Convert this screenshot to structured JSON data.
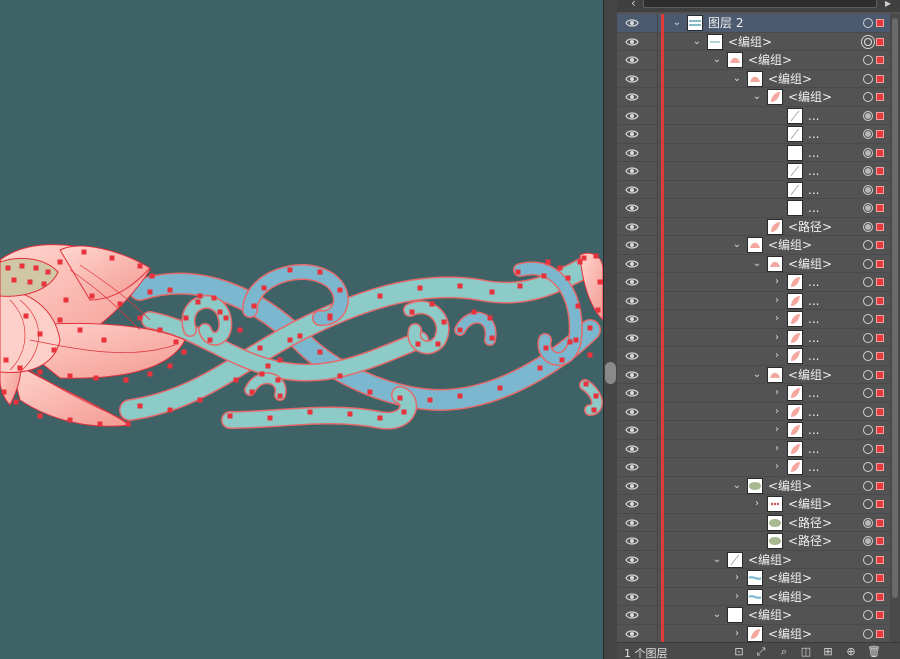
{
  "panel": {
    "search_placeholder": "",
    "layer_count": "1 个图层",
    "rows": [
      {
        "name": "图层 2",
        "depth": 0,
        "chevron": "expanded",
        "thumb": "layer",
        "selected": true,
        "target": "hollow"
      },
      {
        "name": "<编组>",
        "depth": 1,
        "chevron": "expanded",
        "thumb": "group",
        "target": "double"
      },
      {
        "name": "<编组>",
        "depth": 2,
        "chevron": "expanded",
        "thumb": "lotus",
        "target": "hollow"
      },
      {
        "name": "<编组>",
        "depth": 3,
        "chevron": "expanded",
        "thumb": "lotus",
        "target": "hollow"
      },
      {
        "name": "<编组>",
        "depth": 4,
        "chevron": "expanded",
        "thumb": "petal",
        "target": "hollow"
      },
      {
        "name": "...",
        "depth": 5,
        "chevron": "none",
        "thumb": "line",
        "target": "filled"
      },
      {
        "name": "...",
        "depth": 5,
        "chevron": "none",
        "thumb": "line",
        "target": "filled"
      },
      {
        "name": "...",
        "depth": 5,
        "chevron": "none",
        "thumb": "blank",
        "target": "filled"
      },
      {
        "name": "...",
        "depth": 5,
        "chevron": "none",
        "thumb": "line",
        "target": "filled"
      },
      {
        "name": "...",
        "depth": 5,
        "chevron": "none",
        "thumb": "line",
        "target": "filled"
      },
      {
        "name": "...",
        "depth": 5,
        "chevron": "none",
        "thumb": "blank",
        "target": "filled"
      },
      {
        "name": "<路径>",
        "depth": 4,
        "chevron": "none",
        "thumb": "petal",
        "target": "filled"
      },
      {
        "name": "<编组>",
        "depth": 3,
        "chevron": "expanded",
        "thumb": "lotus",
        "target": "hollow"
      },
      {
        "name": "<编组>",
        "depth": 4,
        "chevron": "expanded",
        "thumb": "lotus",
        "target": "hollow"
      },
      {
        "name": "...",
        "depth": 5,
        "chevron": "collapsed",
        "thumb": "petal",
        "target": "hollow"
      },
      {
        "name": "...",
        "depth": 5,
        "chevron": "collapsed",
        "thumb": "petal",
        "target": "hollow"
      },
      {
        "name": "...",
        "depth": 5,
        "chevron": "collapsed",
        "thumb": "petal",
        "target": "hollow"
      },
      {
        "name": "...",
        "depth": 5,
        "chevron": "collapsed",
        "thumb": "petal",
        "target": "hollow"
      },
      {
        "name": "...",
        "depth": 5,
        "chevron": "collapsed",
        "thumb": "petal",
        "target": "hollow"
      },
      {
        "name": "<编组>",
        "depth": 4,
        "chevron": "expanded",
        "thumb": "lotus",
        "target": "hollow"
      },
      {
        "name": "...",
        "depth": 5,
        "chevron": "collapsed",
        "thumb": "petal",
        "target": "hollow"
      },
      {
        "name": "...",
        "depth": 5,
        "chevron": "collapsed",
        "thumb": "petal",
        "target": "hollow"
      },
      {
        "name": "...",
        "depth": 5,
        "chevron": "collapsed",
        "thumb": "petal",
        "target": "hollow"
      },
      {
        "name": "...",
        "depth": 5,
        "chevron": "collapsed",
        "thumb": "petal",
        "target": "hollow"
      },
      {
        "name": "...",
        "depth": 5,
        "chevron": "collapsed",
        "thumb": "petal",
        "target": "hollow"
      },
      {
        "name": "<编组>",
        "depth": 3,
        "chevron": "expanded",
        "thumb": "seedpod",
        "target": "hollow"
      },
      {
        "name": "<编组>",
        "depth": 4,
        "chevron": "collapsed",
        "thumb": "dots",
        "target": "hollow"
      },
      {
        "name": "<路径>",
        "depth": 4,
        "chevron": "none",
        "thumb": "seedpod",
        "target": "filled"
      },
      {
        "name": "<路径>",
        "depth": 4,
        "chevron": "none",
        "thumb": "seedpod",
        "target": "filled"
      },
      {
        "name": "<编组>",
        "depth": 2,
        "chevron": "expanded",
        "thumb": "line",
        "target": "hollow"
      },
      {
        "name": "<编组>",
        "depth": 3,
        "chevron": "collapsed",
        "thumb": "scroll",
        "target": "hollow"
      },
      {
        "name": "<编组>",
        "depth": 3,
        "chevron": "collapsed",
        "thumb": "scroll",
        "target": "hollow"
      },
      {
        "name": "<编组>",
        "depth": 2,
        "chevron": "expanded",
        "thumb": "blank",
        "target": "hollow"
      },
      {
        "name": "<编组>",
        "depth": 3,
        "chevron": "collapsed",
        "thumb": "petal",
        "target": "hollow"
      }
    ]
  },
  "colors": {
    "canvas_bg": "#3f6267",
    "panel_bg": "#535353",
    "selected_row": "#4c5a70",
    "layer_color": "#e03a3a",
    "vine_blue": "#7bb8cf",
    "vine_teal": "#8ccbc8",
    "petal_pink": "#f7b8b0",
    "anchor_red": "#e8323c"
  },
  "icons": {
    "eye": "eye-icon",
    "bottom_toolbar": [
      "export-icon",
      "locate-object-icon",
      "search-icon",
      "clipping-mask-icon",
      "new-sublayer-icon",
      "new-layer-icon",
      "trash-icon"
    ]
  }
}
